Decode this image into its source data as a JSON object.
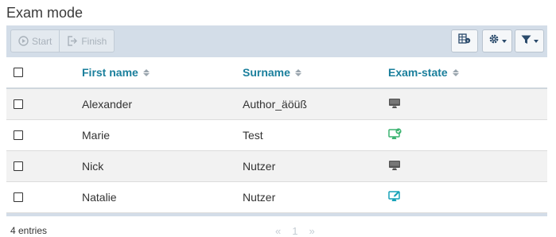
{
  "page": {
    "title": "Exam mode"
  },
  "toolbar": {
    "start_label": "Start",
    "finish_label": "Finish",
    "buttons": [
      "table-info-icon",
      "gear-icon",
      "filter-icon"
    ]
  },
  "table": {
    "columns": [
      "First name",
      "Surname",
      "Exam-state"
    ],
    "rows": [
      {
        "first_name": "Alexander",
        "surname": "Author_äöüß",
        "state_icon": "monitor-icon",
        "state_color": "#555555"
      },
      {
        "first_name": "Marie",
        "surname": "Test",
        "state_icon": "monitor-check-icon",
        "state_color": "#3cb371"
      },
      {
        "first_name": "Nick",
        "surname": "Nutzer",
        "state_icon": "monitor-icon",
        "state_color": "#555555"
      },
      {
        "first_name": "Natalie",
        "surname": "Nutzer",
        "state_icon": "monitor-edit-icon",
        "state_color": "#17a2b8"
      }
    ]
  },
  "footer": {
    "entries_text": "4 entries",
    "pager": {
      "prev": "«",
      "page": "1",
      "next": "»"
    }
  }
}
